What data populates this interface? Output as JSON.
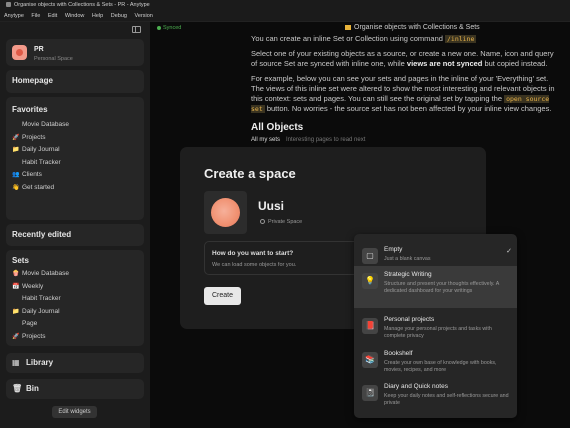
{
  "window": {
    "title": "Organise objects with Collections & Sets - PR - Anytype"
  },
  "menubar": [
    "Anytype",
    "File",
    "Edit",
    "Window",
    "Help",
    "Debug",
    "Version"
  ],
  "sidebar": {
    "space_name": "PR",
    "space_sub": "Personal Space",
    "homepage": "Homepage",
    "favorites_title": "Favorites",
    "favorites": [
      {
        "icon": "",
        "label": "Movie Database"
      },
      {
        "icon": "🚀",
        "label": "Projects"
      },
      {
        "icon": "📁",
        "label": "Daily Journal"
      },
      {
        "icon": "",
        "label": "Habit Tracker"
      },
      {
        "icon": "👥",
        "label": "Clients"
      },
      {
        "icon": "👋",
        "label": "Get started"
      }
    ],
    "recent_title": "Recently edited",
    "sets_title": "Sets",
    "sets": [
      {
        "icon": "🍿",
        "label": "Movie Database"
      },
      {
        "icon": "📅",
        "label": "Weekly"
      },
      {
        "icon": "",
        "label": "Habit Tracker"
      },
      {
        "icon": "📁",
        "label": "Daily Journal"
      },
      {
        "icon": "",
        "label": "Page"
      },
      {
        "icon": "🚀",
        "label": "Projects"
      }
    ],
    "library": "Library",
    "bin": "Bin",
    "edit_widgets": "Edit widgets"
  },
  "doc": {
    "synced": "Synced",
    "title": "Organise objects with Collections & Sets",
    "line1": "You can create an inline Set or Collection using command",
    "line1_code": "/inline",
    "p2_a": "Select one of your existing objects as a source, or create a new one. Name, icon and query of source Set are synced with inline one, while ",
    "p2_b": "views are not synced",
    "p2_c": " but copied instead.",
    "p3_a": "For example, below you can see your sets and pages in the inline of your 'Everything' set. The views of this inline set were altered to show the most interesting and relevant objects in this context: sets and pages. You can still see the original set by tapping the ",
    "p3_code": "open source set",
    "p3_b": " button. No worries - the source set has not been affected by your inline view changes.",
    "all_objects": "All Objects",
    "tab_sets": "All my sets",
    "tab_pages": "Interesting pages to read next"
  },
  "modal": {
    "title": "Create a space",
    "space_name": "Uusi",
    "privacy": "Private Space",
    "start_question": "How do you want to start?",
    "start_sub": "We can load some objects for you.",
    "create": "Create"
  },
  "options": [
    {
      "icon": "▢",
      "title": "Empty",
      "desc": "Just a blank canvas",
      "checked": "✓"
    },
    {
      "icon": "💡",
      "title": "Strategic Writing",
      "desc": "Structure and present your thoughts effectively. A dedicated dashboard for your writings",
      "checked": ""
    },
    {
      "icon": "📕",
      "title": "Personal projects",
      "desc": "Manage your personal projects and tasks with complete privacy",
      "checked": ""
    },
    {
      "icon": "📚",
      "title": "Bookshelf",
      "desc": "Create your own base of knowledge with books, movies, recipes, and more",
      "checked": ""
    },
    {
      "icon": "📓",
      "title": "Diary and Quick notes",
      "desc": "Keep your daily notes and self-reflections secure and private",
      "checked": ""
    }
  ]
}
